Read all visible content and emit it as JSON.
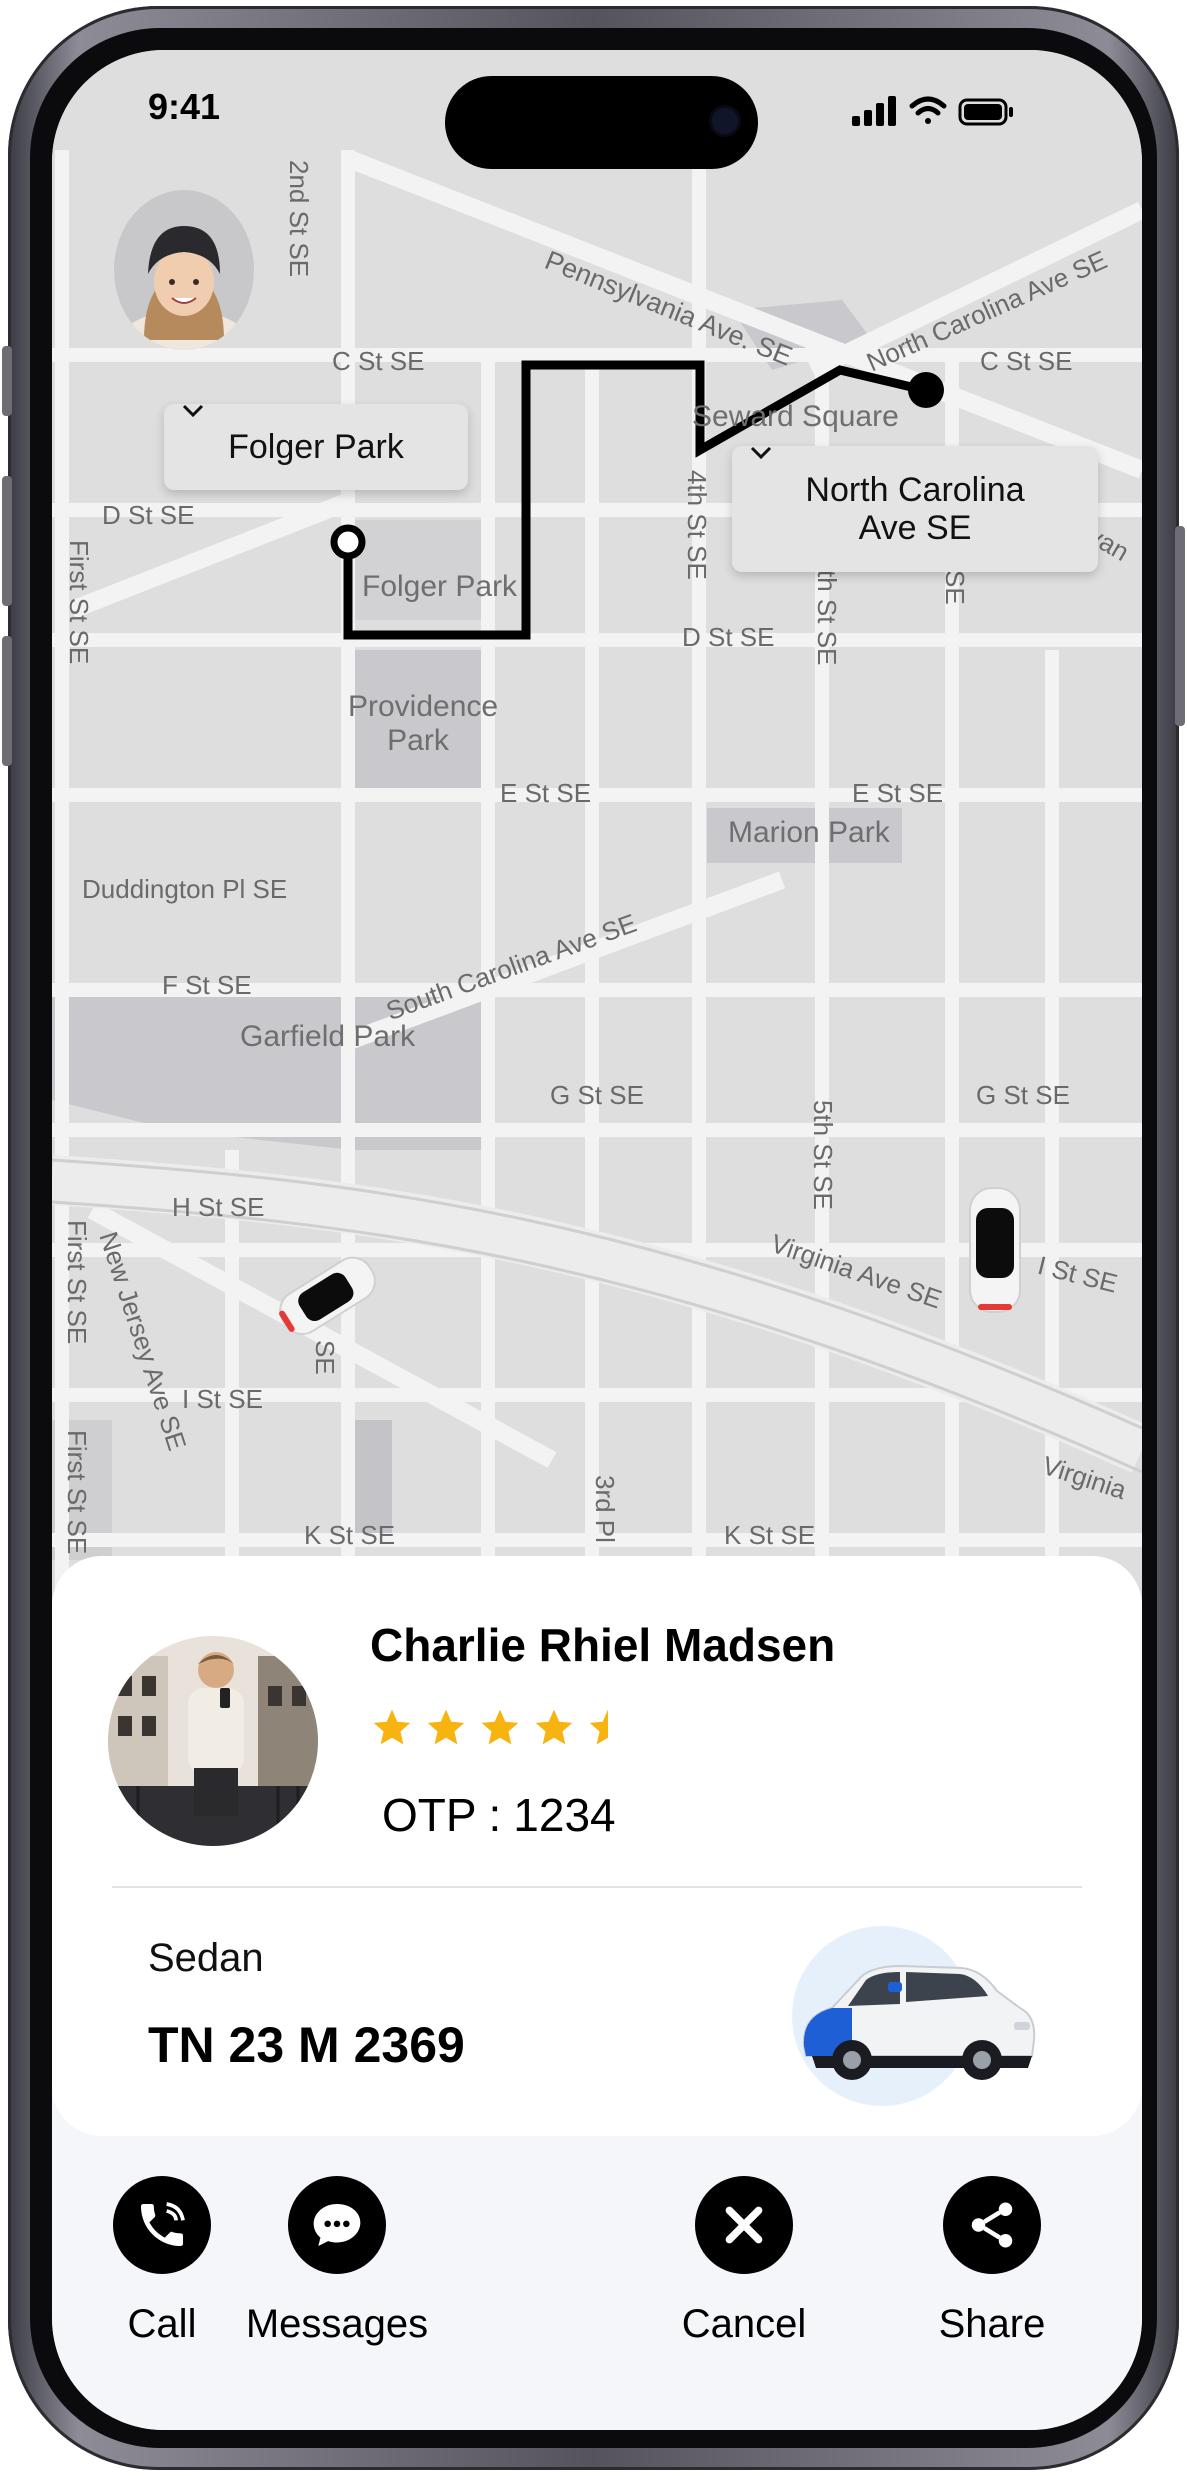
{
  "status_bar": {
    "time": "9:41"
  },
  "map": {
    "pickup": {
      "label": "Folger Park"
    },
    "dropoff": {
      "label_line1": "North Carolina",
      "label_line2": "Ave SE"
    },
    "streets": {
      "s2nd": "2nd St SE",
      "penn": "Pennsylvania Ave. SE",
      "nc_ave": "North Carolina Ave SE",
      "c_st_left": "C St SE",
      "c_st_right": "C St SE",
      "seward": "Seward Square",
      "d_st_left": "D St SE",
      "first": "First St SE",
      "folger_park": "Folger Park",
      "fourth": "4th St SE",
      "d_st_mid": "D St SE",
      "th_st": "th St SE",
      "se_frag": "SE",
      "van_frag": "van",
      "providence": "Providence Park",
      "e_st_mid": "E St SE",
      "e_st_right": "E St SE",
      "marion": "Marion Park",
      "duddington": "Duddington Pl SE",
      "south_carolina": "South Carolina Ave SE",
      "f_st": "F St SE",
      "garfield": "Garfield Park",
      "g_st_mid": "G St SE",
      "g_st_right": "G St SE",
      "fifth": "5th St SE",
      "h_st": "H St SE",
      "virginia_mid": "Virginia Ave SE",
      "i_st_right": "I St SE",
      "new_jersey": "New Jersey Ave SE",
      "i_st_left": "I St SE",
      "first_bottom": "First St SE",
      "first_low": "First St SE",
      "third": "3rd Pl",
      "k_st_left": "K St SE",
      "k_st_mid": "K St SE",
      "virginia_right": "Virginia",
      "se_2nd_low": "SE"
    }
  },
  "driver": {
    "name": "Charlie Rhiel Madsen",
    "rating": 4.5,
    "otp_label": "OTP :",
    "otp_value": "1234"
  },
  "vehicle": {
    "type": "Sedan",
    "plate": "TN 23 M 2369"
  },
  "actions": [
    {
      "label": "Call",
      "icon": "phone-icon"
    },
    {
      "label": "Messages",
      "icon": "message-icon"
    },
    {
      "label": "Cancel",
      "icon": "close-icon"
    },
    {
      "label": "Share",
      "icon": "share-icon"
    }
  ],
  "colors": {
    "star": "#f7b30f",
    "route": "#000000",
    "map_bg": "#dedede",
    "park": "#c9c9cd"
  }
}
